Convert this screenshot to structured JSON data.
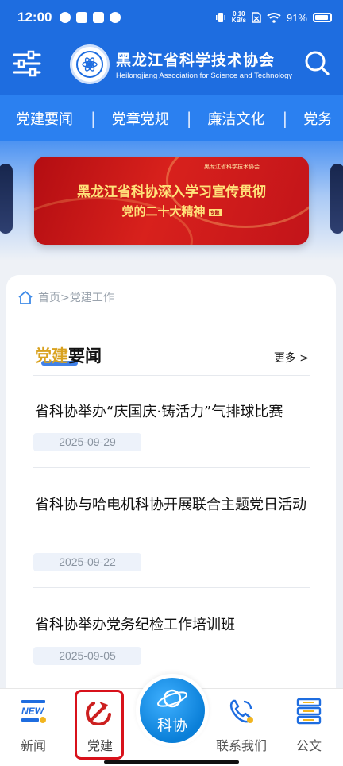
{
  "status_bar": {
    "time": "12:00",
    "net_speed_value": "0.10",
    "net_speed_unit": "KB/s",
    "battery": "91%"
  },
  "header": {
    "logo_cn": "黑龙江省科学技术协会",
    "logo_en": "Heilongjiang Association for Science and Technology"
  },
  "nav_tabs": [
    "党建要闻",
    "党章党规",
    "廉洁文化",
    "党务"
  ],
  "banner": {
    "header_text": "黑龙江省科学技术协会",
    "line1": "黑龙江省科协深入学习宣传贯彻",
    "line2": "党的二十大精神",
    "badge": "专题"
  },
  "breadcrumb": "首页>党建工作",
  "section": {
    "title_part1": "党建",
    "title_part2": "要闻",
    "more": "更多 >"
  },
  "news": [
    {
      "title": "省科协举办“庆国庆·铸活力”气排球比赛",
      "date": "2025-09-29"
    },
    {
      "title": "省科协与哈电机科协开展联合主题党日活动",
      "date": "2025-09-22"
    },
    {
      "title": "省科协举办党务纪检工作培训班",
      "date": "2025-09-05"
    }
  ],
  "tabbar": {
    "news": "新闻",
    "party": "党建",
    "center": "科协",
    "contact": "联系我们",
    "docs": "公文",
    "new_badge": "NEW"
  },
  "colors": {
    "primary": "#1e6de0",
    "accent_red": "#d8111b",
    "gold": "#d9a21f"
  }
}
